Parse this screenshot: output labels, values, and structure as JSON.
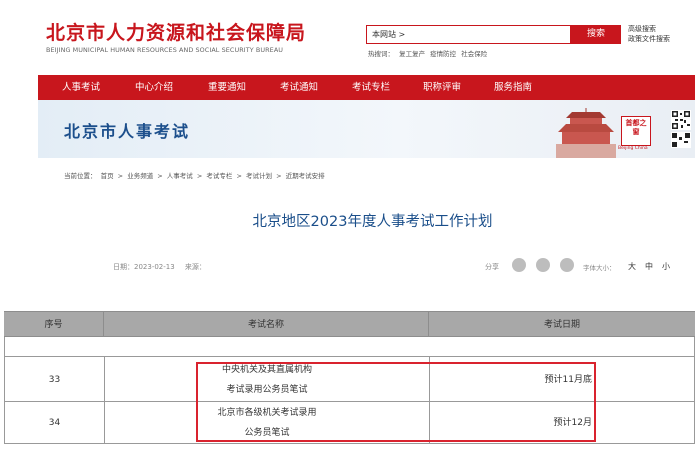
{
  "header": {
    "logo_cn": "北京市人力资源和社会保障局",
    "logo_en": "BEIJING MUNICIPAL HUMAN RESOURCES AND SOCIAL SECURITY BUREAU",
    "search_value": "本网站 >",
    "search_button": "搜索",
    "hot_label": "热搜词：",
    "hot_words": [
      "复工复产",
      "疫情防控",
      "社会保险"
    ],
    "advanced_search": "高级搜索",
    "policy_search": "政策文件搜索"
  },
  "nav": [
    "人事考试",
    "中心介绍",
    "重要通知",
    "考试通知",
    "考试专栏",
    "职称评审",
    "服务指南"
  ],
  "banner": {
    "title": "北京市人事考试",
    "stamp": "首都之窗",
    "stamp_sub": "Beijing China"
  },
  "breadcrumb": {
    "label": "当前位置：",
    "items": [
      "首页",
      ">",
      "业务频道",
      ">",
      "人事考试",
      ">",
      "考试专栏",
      ">",
      "考试计划",
      ">",
      "近期考试安排"
    ]
  },
  "article": {
    "title": "北京地区2023年度人事考试工作计划",
    "date_text": "日期：2023-02-13",
    "source_text": "来源：",
    "share_label": "分享",
    "font_size_label": "字体大小：",
    "font_sizes": [
      "大",
      "中",
      "小"
    ]
  },
  "table": {
    "headers": [
      "序号",
      "考试名称",
      "考试日期"
    ],
    "rows": [
      {
        "index": "33",
        "name_line1": "中央机关及其直属机构",
        "name_line2": "考试录用公务员笔试",
        "date": "预计11月底"
      },
      {
        "index": "34",
        "name_line1": "北京市各级机关考试录用",
        "name_line2": "公务员笔试",
        "date": "预计12月"
      }
    ]
  },
  "colors": {
    "brand_red": "#c8161d",
    "title_blue": "#1a4e8a",
    "highlight_red": "#d9232e",
    "table_header_gray": "#a8a8a8"
  }
}
